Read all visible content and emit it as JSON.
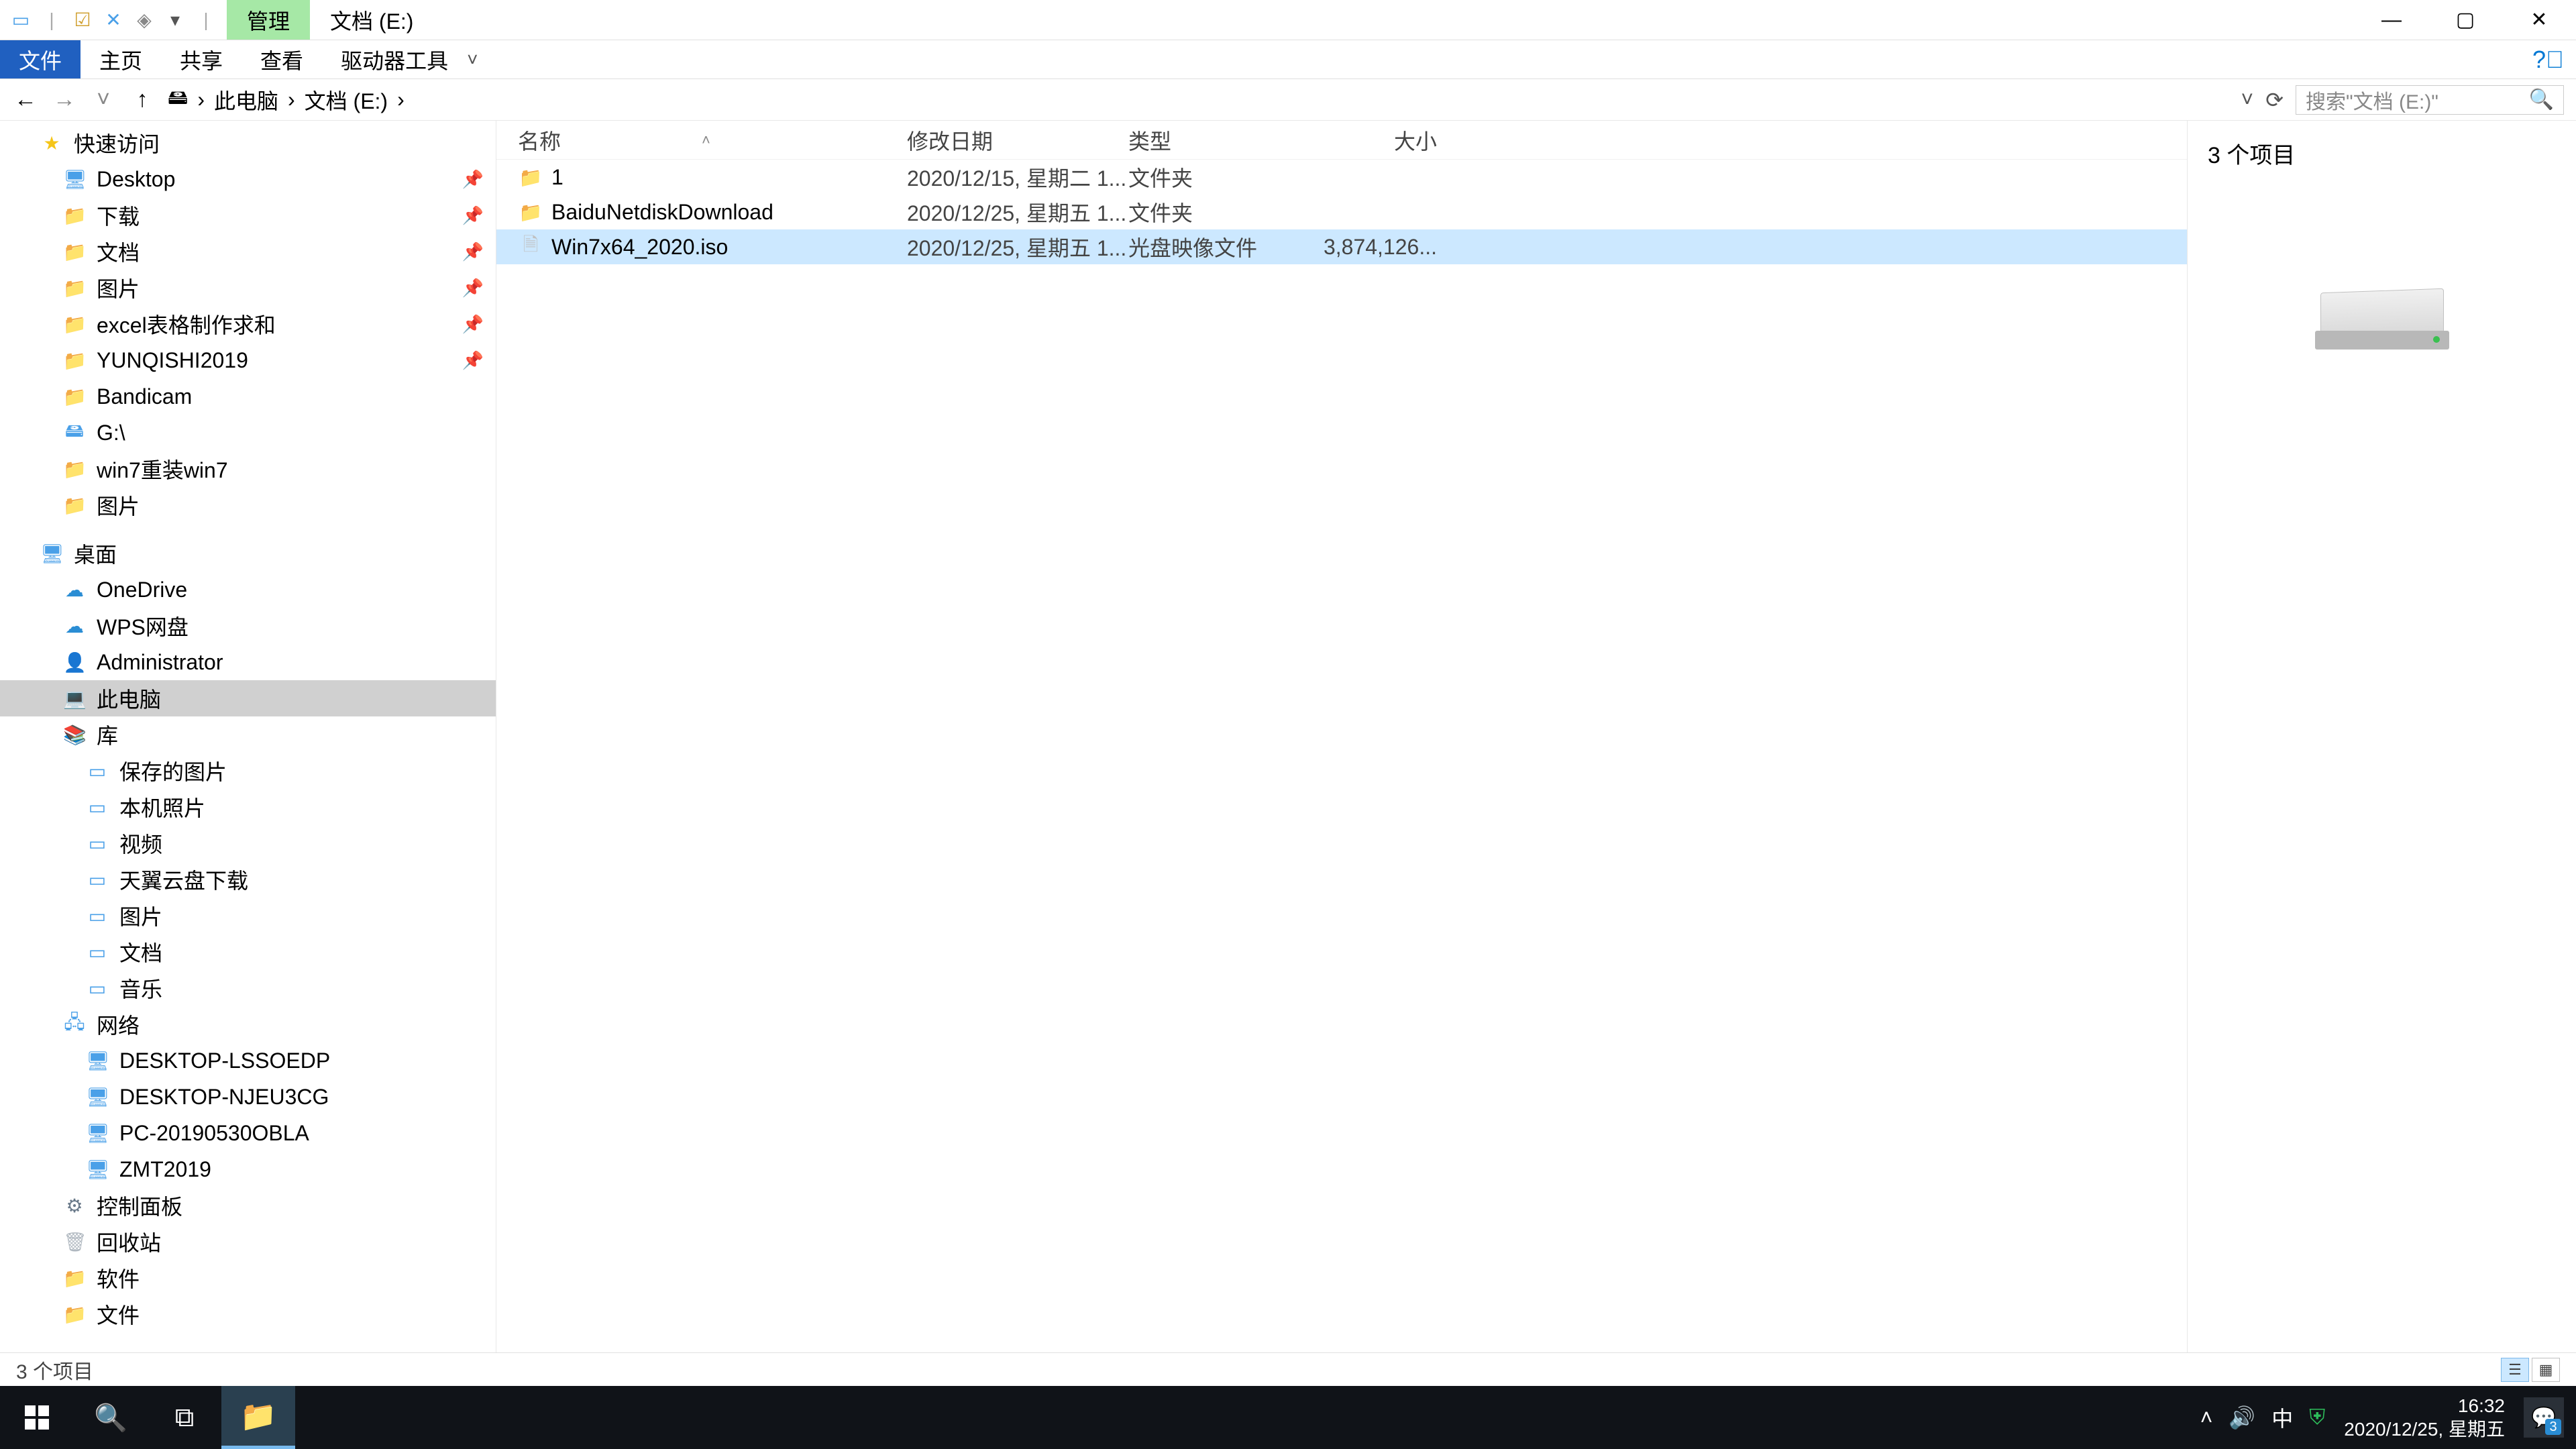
{
  "titlebar": {
    "context_tab": "管理",
    "location_tab": "文档 (E:)"
  },
  "ribbon": {
    "file": "文件",
    "home": "主页",
    "share": "共享",
    "view": "查看",
    "drive_tools": "驱动器工具"
  },
  "breadcrumbs": {
    "items": [
      "此电脑",
      "文档 (E:)"
    ],
    "search_placeholder": "搜索\"文档 (E:)\""
  },
  "nav": {
    "quick_access": "快速访问",
    "quick_items": [
      {
        "label": "Desktop",
        "icon": "desktop",
        "pinned": true
      },
      {
        "label": "下载",
        "icon": "folder",
        "pinned": true
      },
      {
        "label": "文档",
        "icon": "folder",
        "pinned": true
      },
      {
        "label": "图片",
        "icon": "folder",
        "pinned": true
      },
      {
        "label": "excel表格制作求和",
        "icon": "folder",
        "pinned": true
      },
      {
        "label": "YUNQISHI2019",
        "icon": "folder",
        "pinned": true
      },
      {
        "label": "Bandicam",
        "icon": "folder",
        "pinned": false
      },
      {
        "label": "G:\\",
        "icon": "drive",
        "pinned": false
      },
      {
        "label": "win7重装win7",
        "icon": "folder",
        "pinned": false
      },
      {
        "label": "图片",
        "icon": "folder",
        "pinned": false
      }
    ],
    "desktop": "桌面",
    "desktop_items": [
      {
        "label": "OneDrive",
        "icon": "cloud"
      },
      {
        "label": "WPS网盘",
        "icon": "cloud"
      },
      {
        "label": "Administrator",
        "icon": "user"
      },
      {
        "label": "此电脑",
        "icon": "pc",
        "selected": true
      },
      {
        "label": "库",
        "icon": "lib"
      }
    ],
    "libraries": [
      {
        "label": "保存的图片"
      },
      {
        "label": "本机照片"
      },
      {
        "label": "视频"
      },
      {
        "label": "天翼云盘下载"
      },
      {
        "label": "图片"
      },
      {
        "label": "文档"
      },
      {
        "label": "音乐"
      }
    ],
    "network": "网络",
    "network_items": [
      {
        "label": "DESKTOP-LSSOEDP"
      },
      {
        "label": "DESKTOP-NJEU3CG"
      },
      {
        "label": "PC-20190530OBLA"
      },
      {
        "label": "ZMT2019"
      }
    ],
    "control_panel": "控制面板",
    "recycle": "回收站",
    "software": "软件",
    "docs": "文件"
  },
  "columns": {
    "name": "名称",
    "date": "修改日期",
    "type": "类型",
    "size": "大小"
  },
  "files": [
    {
      "name": "1",
      "date": "2020/12/15, 星期二 1...",
      "type": "文件夹",
      "size": "",
      "icon": "folder",
      "selected": false
    },
    {
      "name": "BaiduNetdiskDownload",
      "date": "2020/12/25, 星期五 1...",
      "type": "文件夹",
      "size": "",
      "icon": "folder",
      "selected": false
    },
    {
      "name": "Win7x64_2020.iso",
      "date": "2020/12/25, 星期五 1...",
      "type": "光盘映像文件",
      "size": "3,874,126...",
      "icon": "file",
      "selected": true
    }
  ],
  "preview": {
    "count_label": "3 个项目"
  },
  "statusbar": {
    "text": "3 个项目"
  },
  "taskbar": {
    "time": "16:32",
    "date": "2020/12/25, 星期五",
    "ime": "中",
    "notif_count": "3"
  }
}
